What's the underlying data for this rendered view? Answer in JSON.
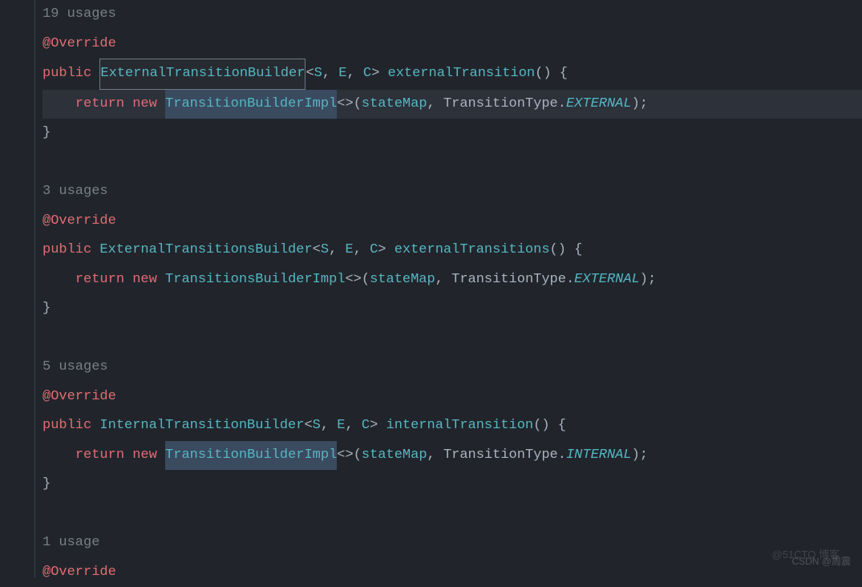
{
  "blocks": [
    {
      "usages": "19 usages",
      "annotation": "@Override",
      "sig": {
        "keyword": "public",
        "return_type": "ExternalTransitionBuilder",
        "generics": [
          "S",
          "E",
          "C"
        ],
        "method_name": "externalTransition"
      },
      "body": {
        "ret": "return",
        "new": "new",
        "impl": "TransitionBuilderImpl",
        "args_field": "stateMap",
        "args_class": "TransitionType",
        "args_enum": "EXTERNAL"
      },
      "box_return_type": true,
      "impl_selected": true,
      "body_highlighted": true
    },
    {
      "usages": "3 usages",
      "annotation": "@Override",
      "sig": {
        "keyword": "public",
        "return_type": "ExternalTransitionsBuilder",
        "generics": [
          "S",
          "E",
          "C"
        ],
        "method_name": "externalTransitions"
      },
      "body": {
        "ret": "return",
        "new": "new",
        "impl": "TransitionsBuilderImpl",
        "args_field": "stateMap",
        "args_class": "TransitionType",
        "args_enum": "EXTERNAL"
      },
      "box_return_type": false,
      "impl_selected": false,
      "body_highlighted": false
    },
    {
      "usages": "5 usages",
      "annotation": "@Override",
      "sig": {
        "keyword": "public",
        "return_type": "InternalTransitionBuilder",
        "generics": [
          "S",
          "E",
          "C"
        ],
        "method_name": "internalTransition"
      },
      "body": {
        "ret": "return",
        "new": "new",
        "impl": "TransitionBuilderImpl",
        "args_field": "stateMap",
        "args_class": "TransitionType",
        "args_enum": "INTERNAL"
      },
      "box_return_type": false,
      "impl_selected": true,
      "body_highlighted": false
    }
  ],
  "trailing": {
    "usages": "1 usage",
    "annotation": "@Override"
  },
  "watermarks": {
    "w1": "@51CTO 博客",
    "w2": "CSDN @周震"
  },
  "punct": {
    "langle": "<",
    "rangle": ">",
    "comma": ", ",
    "lparen": "(",
    "rparen": ")",
    "lbrace": " {",
    "rbrace": "}",
    "semi": ";",
    "dot": ".",
    "diamond": "<>",
    "emptyparen": "()"
  }
}
